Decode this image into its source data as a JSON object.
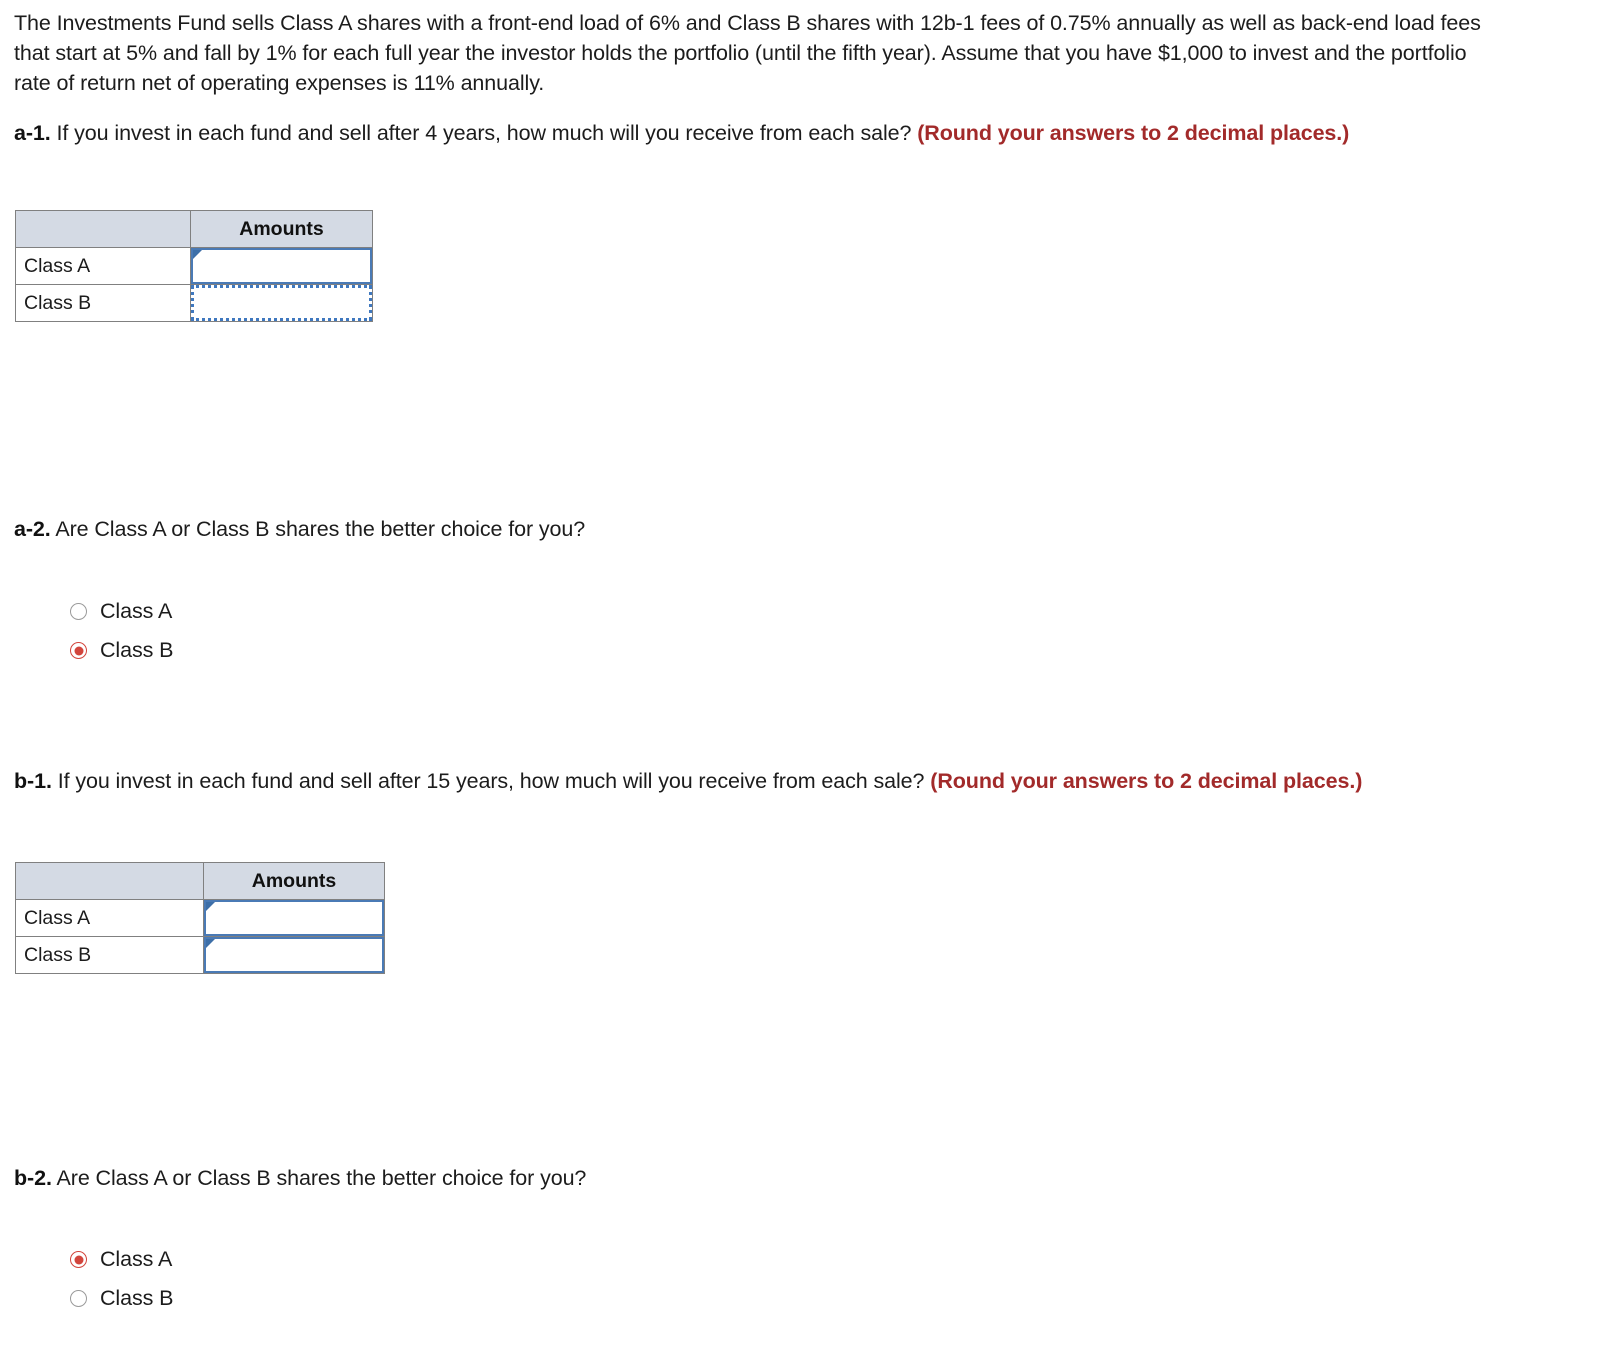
{
  "intro": {
    "text": "The Investments Fund sells Class A shares with a front-end load of 6% and Class B shares with 12b-1 fees of 0.75% annually as well as back-end load fees that start at 5% and fall by 1% for each full year the investor holds the portfolio (until the fifth year). Assume that you have $1,000 to invest and the portfolio rate of return net of operating expenses is 11% annually."
  },
  "questions": {
    "a1": {
      "label": "a-1.",
      "body": "If you invest in each fund and sell after 4 years, how much will you receive from each sale?",
      "note": "(Round your answers to 2 decimal places.)"
    },
    "a2": {
      "label": "a-2.",
      "body": "Are Class A or Class B shares the better choice for you?"
    },
    "b1": {
      "label": "b-1.",
      "body": "If you invest in each fund and sell after 15 years, how much will you receive from each sale?",
      "note": "(Round your answers to 2 decimal places.)"
    },
    "b2": {
      "label": "b-2.",
      "body": "Are Class A or Class B shares the better choice for you?"
    }
  },
  "table_a": {
    "header_blank": "",
    "header_amounts": "Amounts",
    "rows": [
      {
        "label": "Class A",
        "value": ""
      },
      {
        "label": "Class B",
        "value": ""
      }
    ]
  },
  "table_b": {
    "header_blank": "",
    "header_amounts": "Amounts",
    "rows": [
      {
        "label": "Class A",
        "value": ""
      },
      {
        "label": "Class B",
        "value": ""
      }
    ]
  },
  "radios_a2": {
    "options": [
      {
        "label": "Class A",
        "selected": false
      },
      {
        "label": "Class B",
        "selected": true
      }
    ]
  },
  "radios_b2": {
    "options": [
      {
        "label": "Class A",
        "selected": true
      },
      {
        "label": "Class B",
        "selected": false
      }
    ]
  },
  "colors": {
    "note_red": "#a22a2a",
    "radio_selected": "#d2453c",
    "table_header_bg": "#d4dae4",
    "input_border_blue": "#4a7ab5",
    "input_border_dotted": "#3f78bf",
    "table_grid": "#808080"
  }
}
